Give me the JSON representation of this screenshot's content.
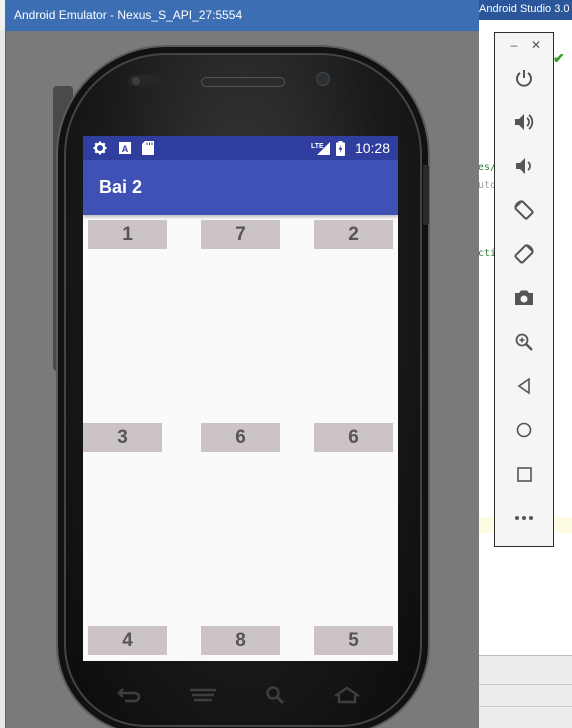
{
  "studio": {
    "title": "Android Studio 3.0",
    "code_fragments": [
      "es/",
      "uto",
      "ctiv"
    ]
  },
  "emulator": {
    "window_title": "Android Emulator - Nexus_S_API_27:5554"
  },
  "phone": {
    "status_bar": {
      "time": "10:28",
      "left_icons": [
        "settings-icon",
        "a-notification-icon",
        "sd-card-icon"
      ],
      "right_icons": [
        "lte-signal-icon",
        "battery-icon"
      ]
    },
    "app_bar": {
      "title": "Bai 2"
    },
    "grid": {
      "rows": [
        [
          "1",
          "7",
          "2"
        ],
        [
          "3",
          "6",
          "6"
        ],
        [
          "4",
          "8",
          "5"
        ]
      ]
    },
    "nav_bar": [
      "back-icon",
      "menu-icon",
      "search-icon",
      "home-icon"
    ]
  },
  "controls": {
    "window_buttons": [
      "minimize-icon",
      "close-icon"
    ],
    "buttons": [
      "power-icon",
      "volume-up-icon",
      "volume-down-icon",
      "rotate-left-icon",
      "rotate-right-icon",
      "camera-icon",
      "zoom-icon",
      "back-triangle-icon",
      "home-circle-icon",
      "overview-square-icon",
      "more-icon"
    ]
  },
  "colors": {
    "status_bar": "#303f9f",
    "app_bar": "#3f51b5",
    "cell_bg": "#ccc4c4",
    "cell_text": "#555555",
    "title_bar": "#3c6eb4"
  }
}
